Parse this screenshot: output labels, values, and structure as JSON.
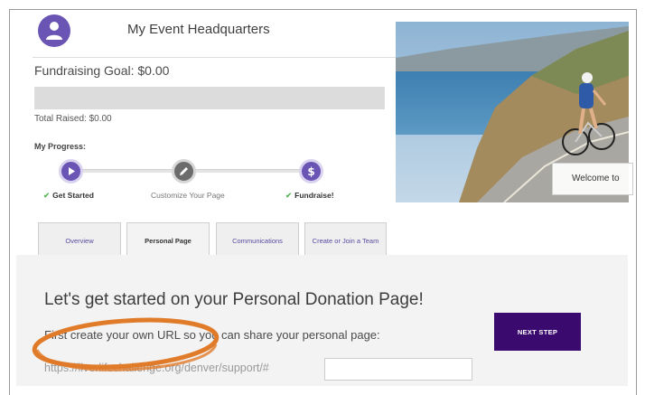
{
  "header": {
    "title": "My Event Headquarters"
  },
  "fundraising": {
    "goal_label": "Fundraising Goal: $0.00",
    "progress": 0,
    "total_raised": "Total Raised: $0.00"
  },
  "progress": {
    "label": "My Progress:",
    "steps": [
      {
        "label": "Get Started",
        "completed": true,
        "icon": "play-icon"
      },
      {
        "label": "Customize Your Page",
        "completed": false,
        "icon": "pencil-icon"
      },
      {
        "label": "Fundraise!",
        "completed": true,
        "icon": "dollar-icon"
      }
    ]
  },
  "hero": {
    "welcome_text": "Welcome to"
  },
  "tabs": [
    {
      "label": "Overview",
      "active": false
    },
    {
      "label": "Personal Page",
      "active": true
    },
    {
      "label": "Communications",
      "active": false
    },
    {
      "label": "Create or Join a Team",
      "active": false
    }
  ],
  "personal_page": {
    "headline": "Let's get started on your Personal Donation Page!",
    "instruction": "First create your own URL so you can share your personal page:",
    "url_prefix": "https://liverlifechallenge.org/denver/support/#",
    "url_value": "",
    "next_label": "NEXT STEP"
  },
  "colors": {
    "brand_purple": "#6a55b5",
    "button_dark_purple": "#3b0a6e",
    "check_green": "#5cb85c",
    "annotation_orange": "#e07b2a"
  }
}
